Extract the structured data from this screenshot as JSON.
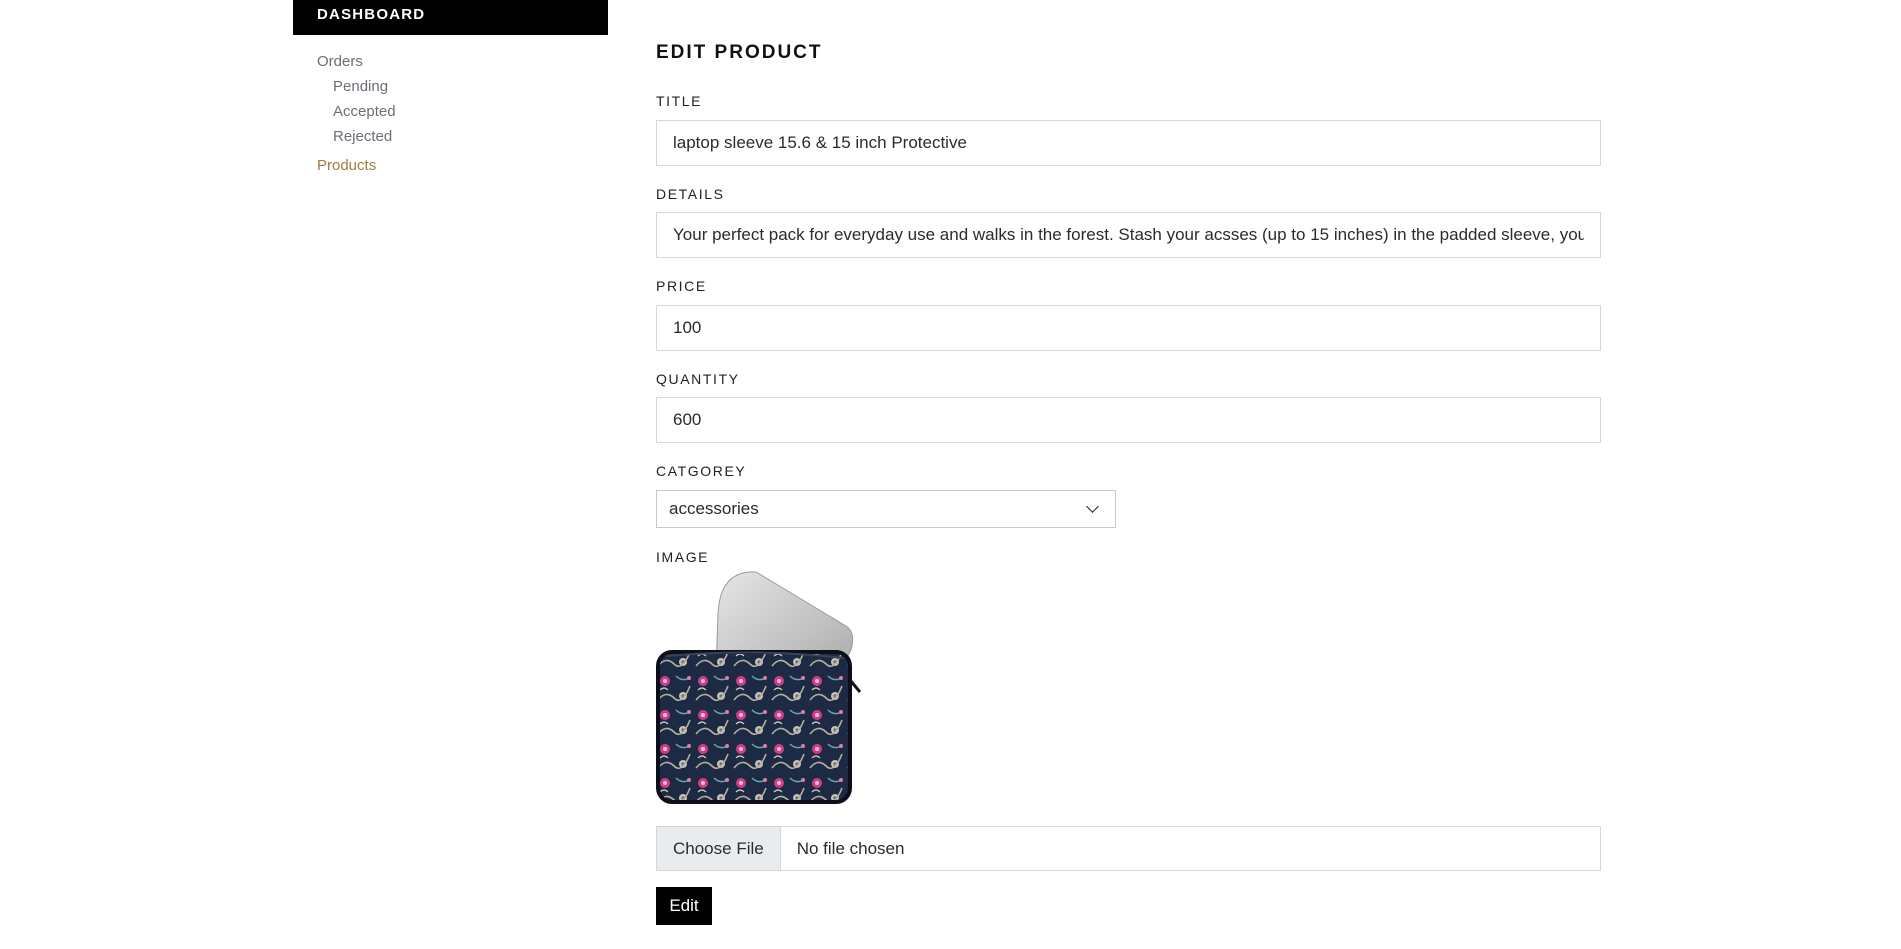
{
  "sidebar": {
    "title": "DASHBOARD",
    "items": [
      {
        "label": "Orders"
      },
      {
        "label": "Pending"
      },
      {
        "label": "Accepted"
      },
      {
        "label": "Rejected"
      },
      {
        "label": "Products"
      }
    ],
    "active_item": "Products",
    "text_color": "#6b6f78",
    "active_color": "#a37b3e"
  },
  "form": {
    "heading": "EDIT PRODUCT",
    "title_label": "TITLE",
    "title_value": "laptop sleeve 15.6 & 15 inch Protective",
    "details_label": "DETAILS",
    "details_value": "Your perfect pack for everyday use and walks in the forest. Stash your acsses (up to 15 inches) in the padded sleeve, your everyday",
    "price_label": "PRICE",
    "price_value": "100",
    "quantity_label": "QUANTITY",
    "quantity_value": "600",
    "category_label": "CATGOREY",
    "category_selected": "accessories",
    "image_label": "IMAGE",
    "image_description_icon": "laptop-sleeve-floral-image",
    "choose_file_label": "Choose File",
    "file_status": "No file chosen",
    "submit_label": "Edit"
  }
}
